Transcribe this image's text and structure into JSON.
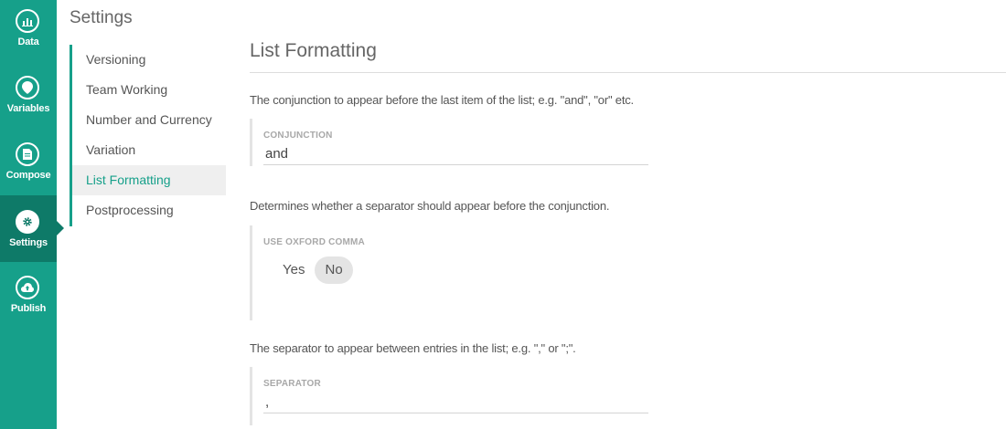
{
  "nav": {
    "items": [
      {
        "label": "Data",
        "icon": "chart-icon"
      },
      {
        "label": "Variables",
        "icon": "location-pin-icon"
      },
      {
        "label": "Compose",
        "icon": "document-icon"
      },
      {
        "label": "Settings",
        "icon": "gear-icon",
        "active": true
      },
      {
        "label": "Publish",
        "icon": "cloud-upload-icon"
      }
    ],
    "accent": "#16a08a"
  },
  "settings": {
    "title": "Settings",
    "menu": [
      "Versioning",
      "Team Working",
      "Number and Currency",
      "Variation",
      "List Formatting",
      "Postprocessing"
    ],
    "active_item": "List Formatting"
  },
  "list_formatting": {
    "title": "List Formatting",
    "conjunction": {
      "description": "The conjunction to appear before the last item of the list; e.g. \"and\", \"or\" etc.",
      "label": "CONJUNCTION",
      "value": "and"
    },
    "oxford_comma": {
      "description": "Determines whether a separator should appear before the conjunction.",
      "label": "USE OXFORD COMMA",
      "options": [
        "Yes",
        "No"
      ],
      "selected": "No"
    },
    "separator": {
      "description": "The separator to appear between entries in the list; e.g. \",\" or \";\".",
      "label": "SEPARATOR",
      "value": ","
    }
  }
}
